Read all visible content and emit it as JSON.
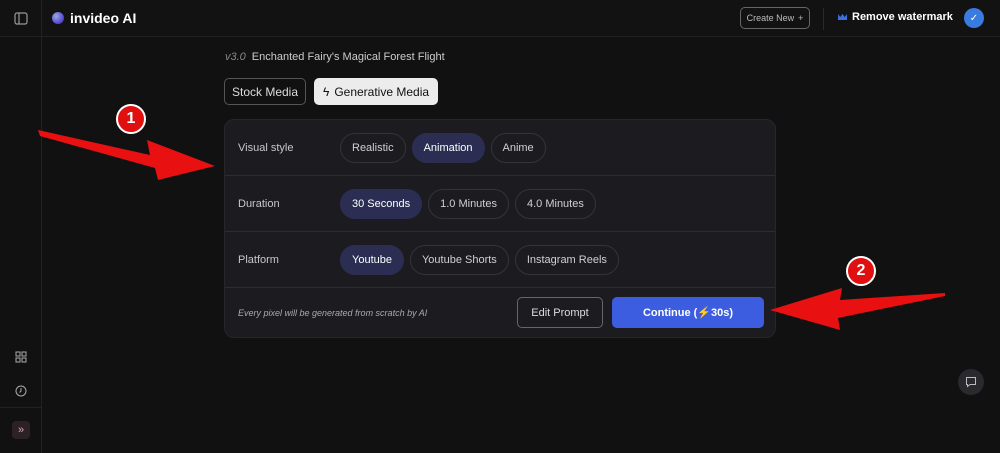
{
  "header": {
    "app_name": "invideo AI",
    "create_new": "Create New",
    "remove_watermark": "Remove watermark"
  },
  "project": {
    "version": "v3.0",
    "title": "Enchanted Fairy's Magical Forest Flight"
  },
  "media_tabs": [
    {
      "label": "Stock Media",
      "selected": false
    },
    {
      "label": "Generative Media",
      "selected": true
    }
  ],
  "settings": {
    "visual_style": {
      "label": "Visual style",
      "options": [
        "Realistic",
        "Animation",
        "Anime"
      ],
      "selected": "Animation"
    },
    "duration": {
      "label": "Duration",
      "options": [
        "30 Seconds",
        "1.0 Minutes",
        "4.0 Minutes"
      ],
      "selected": "30 Seconds"
    },
    "platform": {
      "label": "Platform",
      "options": [
        "Youtube",
        "Youtube Shorts",
        "Instagram Reels"
      ],
      "selected": "Youtube"
    }
  },
  "footer": {
    "note": "Every pixel will be generated from scratch by AI",
    "edit_prompt": "Edit Prompt",
    "continue": "Continue (⚡30s)"
  },
  "annotations": [
    "1",
    "2"
  ],
  "colors": {
    "accent": "#3d5de0",
    "selected_pill": "#2b2e52",
    "arrow": "#e01010"
  }
}
